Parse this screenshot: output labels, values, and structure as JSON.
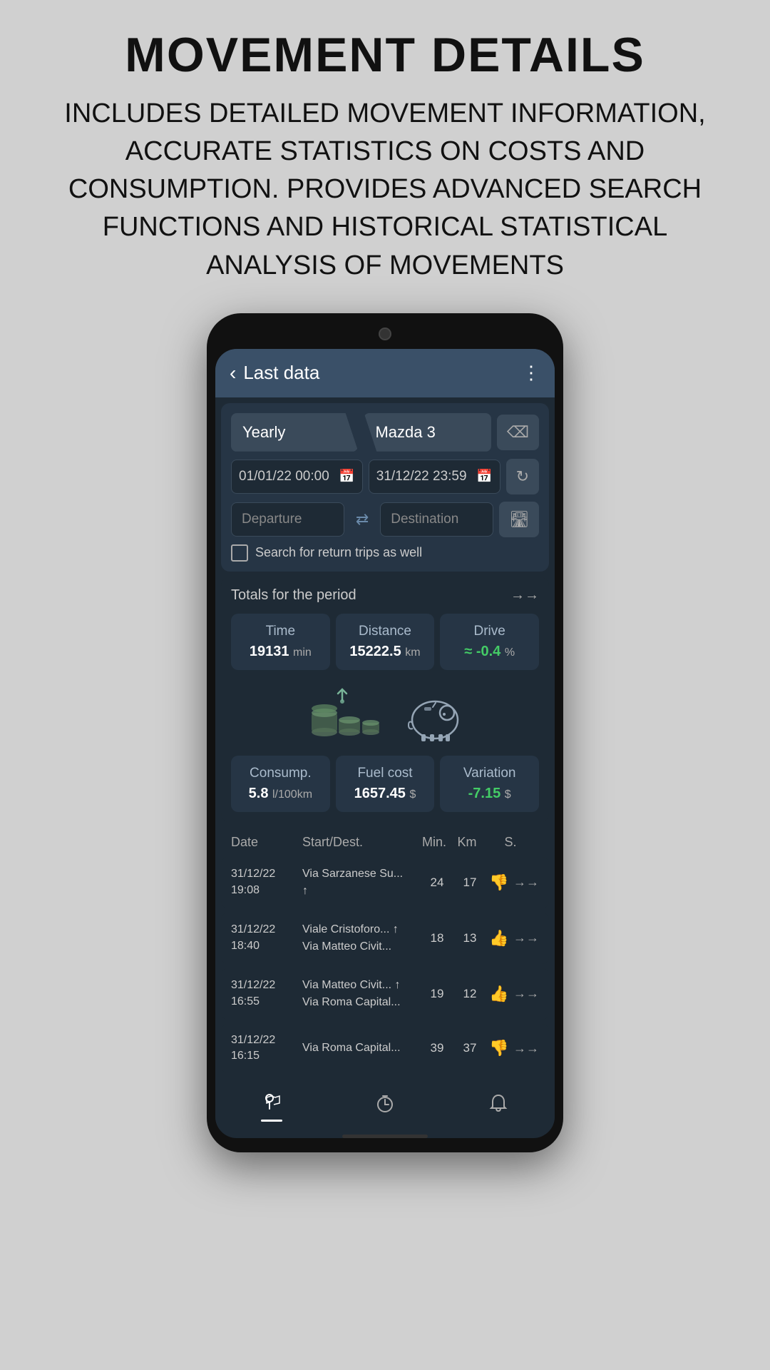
{
  "header": {
    "title": "MOVEMENT DETAILS",
    "subtitle": "INCLUDES DETAILED MOVEMENT INFORMATION, ACCURATE STATISTICS ON COSTS AND CONSUMPTION. PROVIDES ADVANCED SEARCH FUNCTIONS AND HISTORICAL STATISTICAL ANALYSIS OF MOVEMENTS"
  },
  "app": {
    "back_label": "‹",
    "screen_title": "Last data",
    "menu_icon": "⋮",
    "period_label": "Yearly",
    "vehicle_label": "Mazda 3",
    "clear_icon": "⌫",
    "date_from": "01/01/22 00:00",
    "date_to": "31/12/22 23:59",
    "date_icon": "📅",
    "refresh_icon": "↻",
    "departure_placeholder": "Departure",
    "destination_placeholder": "Destination",
    "swap_icon": "⇄",
    "road_icon": "🛣",
    "return_trips_label": "Search for return trips as well",
    "totals_title": "Totals for the period",
    "totals_arrow": "→→",
    "stats": [
      {
        "label": "Time",
        "value": "19131",
        "unit": "min"
      },
      {
        "label": "Distance",
        "value": "15222.5",
        "unit": "km"
      },
      {
        "label": "Drive",
        "value": "≈  -0.4",
        "unit": "%"
      }
    ],
    "costs": [
      {
        "label": "Consump.",
        "value": "5.8",
        "unit": "l/100km"
      },
      {
        "label": "Fuel cost",
        "value": "1657.45",
        "unit": "$"
      },
      {
        "label": "Variation",
        "value": "-7.15",
        "unit": "$",
        "color": "green"
      }
    ],
    "table_headers": [
      "Date",
      "Start/Dest.",
      "Min.",
      "Km",
      "S."
    ],
    "trips": [
      {
        "date": "31/12/22\n19:08",
        "route_line1": "Via Sarzanese Su...",
        "route_line2": "↑",
        "min": "24",
        "km": "17",
        "status": "down",
        "arrow": "→→"
      },
      {
        "date": "31/12/22\n18:40",
        "route_line1": "Viale Cristoforo... ↑",
        "route_line2": "Via Matteo Civit...",
        "min": "18",
        "km": "13",
        "status": "up",
        "arrow": "→→"
      },
      {
        "date": "31/12/22\n16:55",
        "route_line1": "Via Matteo Civit... ↑",
        "route_line2": "Via Roma Capital...",
        "min": "19",
        "km": "12",
        "status": "up",
        "arrow": "→→"
      },
      {
        "date": "31/12/22\n16:15",
        "route_line1": "Via Roma Capital...",
        "route_line2": "",
        "min": "39",
        "km": "37",
        "status": "down",
        "arrow": "→→"
      }
    ],
    "nav": [
      {
        "icon": "◉",
        "label": "map",
        "active": true
      },
      {
        "icon": "⏱",
        "label": "timer",
        "active": false
      },
      {
        "icon": "🔔",
        "label": "bell",
        "active": false
      }
    ]
  }
}
